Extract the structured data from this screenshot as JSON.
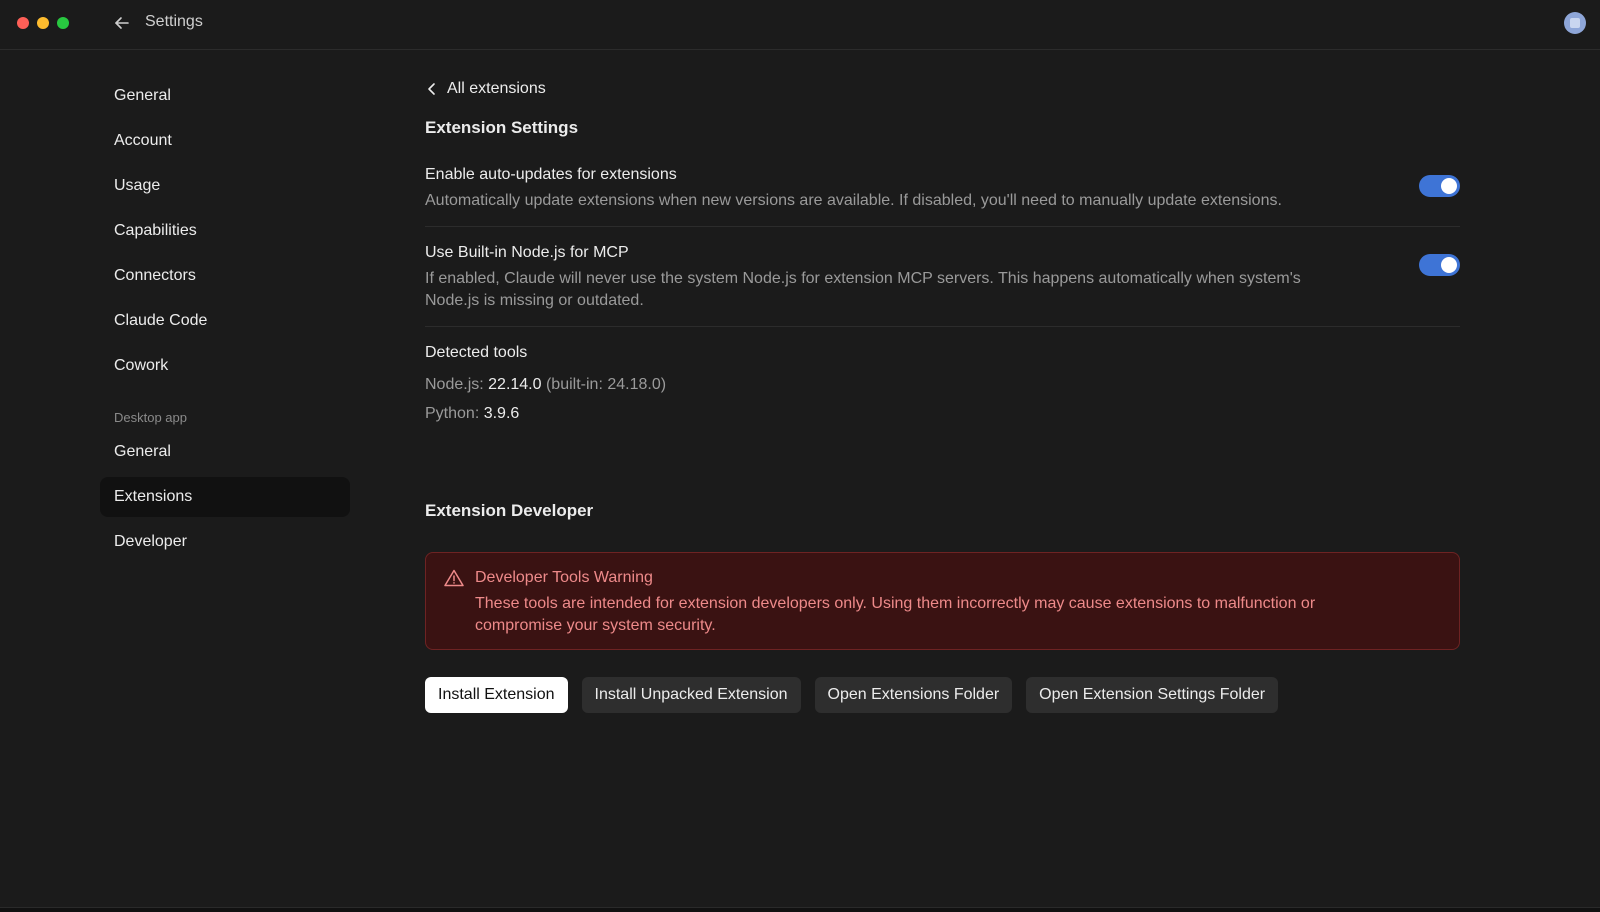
{
  "window": {
    "title": "Settings",
    "colors": {
      "background": "#1b1b1b",
      "accent": "#3e74d6",
      "warning_bg": "#3a1212",
      "warning_text": "#ee8a8a"
    }
  },
  "sidebar": {
    "items": [
      {
        "label": "General"
      },
      {
        "label": "Account"
      },
      {
        "label": "Usage"
      },
      {
        "label": "Capabilities"
      },
      {
        "label": "Connectors"
      },
      {
        "label": "Claude Code"
      },
      {
        "label": "Cowork"
      }
    ],
    "section_label": "Desktop app",
    "desktop_items": [
      {
        "label": "General"
      },
      {
        "label": "Extensions",
        "active": true
      },
      {
        "label": "Developer"
      }
    ]
  },
  "main": {
    "back_link": "All extensions",
    "section_title": "Extension Settings",
    "settings": [
      {
        "title": "Enable auto-updates for extensions",
        "description": "Automatically update extensions when new versions are available. If disabled, you'll need to manually update extensions.",
        "enabled": true
      },
      {
        "title": "Use Built-in Node.js for MCP",
        "description": "If enabled, Claude will never use the system Node.js for extension MCP servers. This happens automatically when system's Node.js is missing or outdated.",
        "enabled": true
      }
    ],
    "detected": {
      "title": "Detected tools",
      "node_label": "Node.js: ",
      "node_version": "22.14.0",
      "node_builtin": " (built-in: 24.18.0)",
      "python_label": "Python: ",
      "python_version": "3.9.6"
    },
    "developer": {
      "title": "Extension Developer",
      "warning_title": "Developer Tools Warning",
      "warning_text": "These tools are intended for extension developers only. Using them incorrectly may cause extensions to malfunction or compromise your system security.",
      "buttons": [
        "Install Extension",
        "Install Unpacked Extension",
        "Open Extensions Folder",
        "Open Extension Settings Folder"
      ]
    }
  }
}
